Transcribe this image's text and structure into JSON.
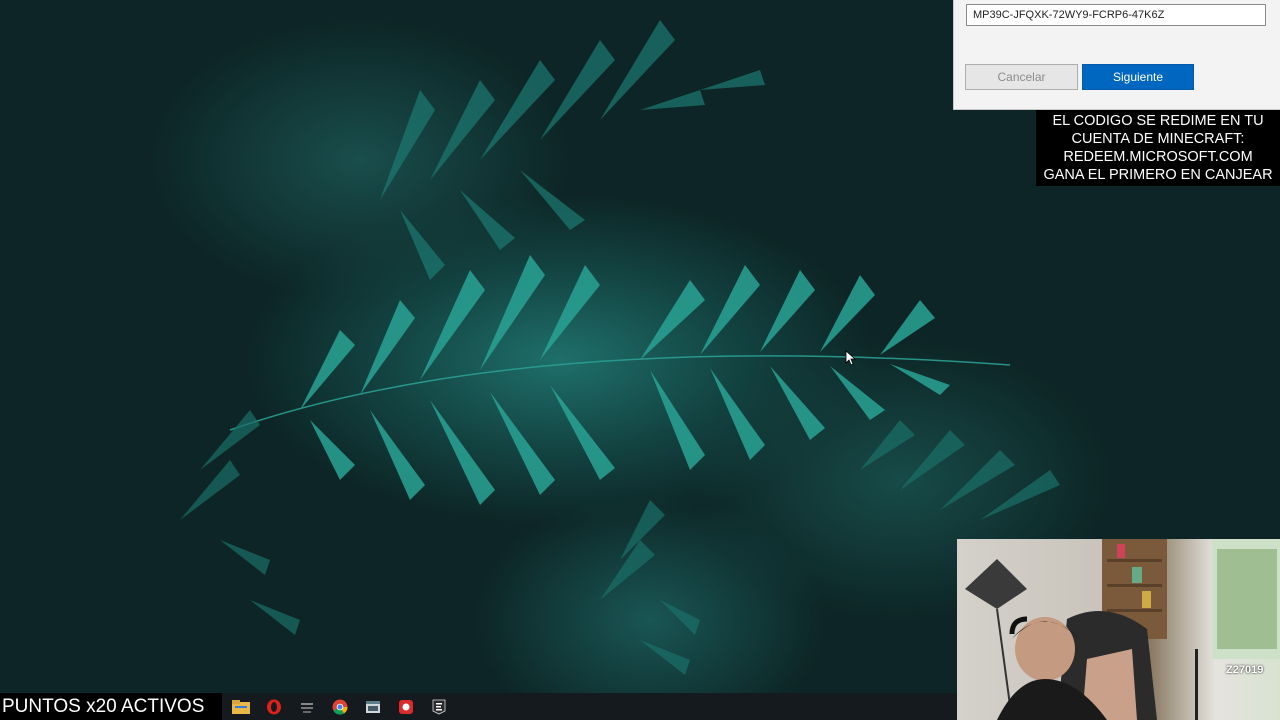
{
  "dialog": {
    "code_value": "MP39C-JFQXK-72WY9-FCRP6-47K6Z",
    "cancel_label": "Cancelar",
    "next_label": "Siguiente"
  },
  "overlay": {
    "lines": [
      "EL CODIGO SE REDIME EN TU",
      "CUENTA DE MINECRAFT:",
      "REDEEM.MICROSOFT.COM",
      "GANA EL PRIMERO EN CANJEAR"
    ]
  },
  "stream": {
    "points_label": "PUNTOS x20 ACTIVOS",
    "webcam_badge": "Z27019"
  },
  "taskbar": {
    "icons": [
      {
        "name": "file-explorer-icon",
        "color": "#e8b84a"
      },
      {
        "name": "opera-icon",
        "color": "#e0201b"
      },
      {
        "name": "app-icon",
        "color": "#888888"
      },
      {
        "name": "chrome-icon",
        "color": "#4285f4"
      },
      {
        "name": "app-window-icon",
        "color": "#cfd8dc"
      },
      {
        "name": "red-app-icon",
        "color": "#d92b2b"
      },
      {
        "name": "epic-games-icon",
        "color": "#2a2a2a"
      }
    ]
  },
  "colors": {
    "accent": "#0067c0",
    "wallpaper_dark": "#0d2526",
    "fern": "#2fb3a6"
  }
}
